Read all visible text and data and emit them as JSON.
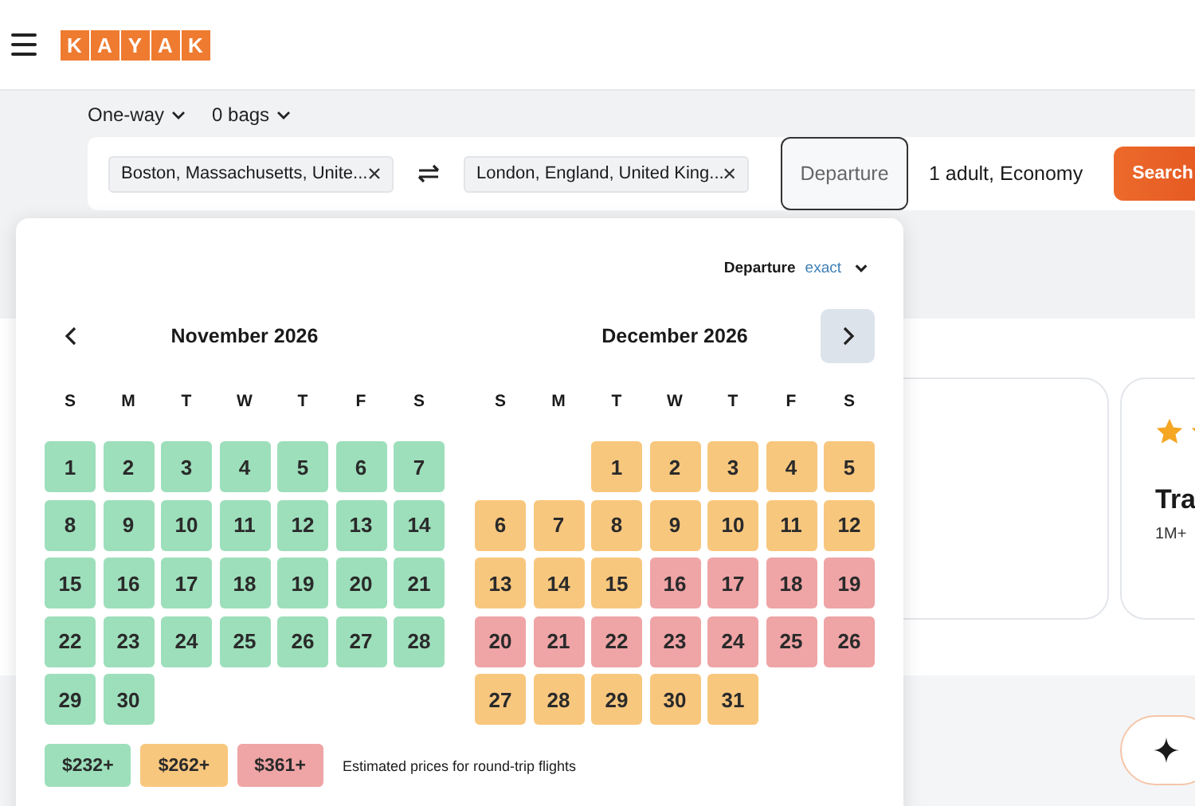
{
  "header": {
    "logo_letters": [
      "K",
      "A",
      "Y",
      "A",
      "K"
    ]
  },
  "trip_options": [
    {
      "label": "One-way"
    },
    {
      "label": "0 bags"
    }
  ],
  "search": {
    "origin": "Boston, Massachusetts, Unite...",
    "destination": "London, England, United King...",
    "departure_placeholder": "Departure",
    "travelers": "1 adult, Economy",
    "button": "Search"
  },
  "calendar": {
    "mode_label": "Departure",
    "mode_value": "exact",
    "months": [
      {
        "title": "November 2026",
        "weekdays": [
          "S",
          "M",
          "T",
          "W",
          "T",
          "F",
          "S"
        ],
        "weeks": [
          [
            {
              "day": "1",
              "kind": "low"
            },
            {
              "day": "2",
              "kind": "low"
            },
            {
              "day": "3",
              "kind": "low"
            },
            {
              "day": "4",
              "kind": "low"
            },
            {
              "day": "5",
              "kind": "low"
            },
            {
              "day": "6",
              "kind": "low"
            },
            {
              "day": "7",
              "kind": "low"
            }
          ],
          [
            {
              "day": "8",
              "kind": "low"
            },
            {
              "day": "9",
              "kind": "low"
            },
            {
              "day": "10",
              "kind": "low"
            },
            {
              "day": "11",
              "kind": "low"
            },
            {
              "day": "12",
              "kind": "low"
            },
            {
              "day": "13",
              "kind": "low"
            },
            {
              "day": "14",
              "kind": "low"
            }
          ],
          [
            {
              "day": "15",
              "kind": "low"
            },
            {
              "day": "16",
              "kind": "low"
            },
            {
              "day": "17",
              "kind": "low"
            },
            {
              "day": "18",
              "kind": "low"
            },
            {
              "day": "19",
              "kind": "low"
            },
            {
              "day": "20",
              "kind": "low"
            },
            {
              "day": "21",
              "kind": "low"
            }
          ],
          [
            {
              "day": "22",
              "kind": "low"
            },
            {
              "day": "23",
              "kind": "low"
            },
            {
              "day": "24",
              "kind": "low"
            },
            {
              "day": "25",
              "kind": "low"
            },
            {
              "day": "26",
              "kind": "low"
            },
            {
              "day": "27",
              "kind": "low"
            },
            {
              "day": "28",
              "kind": "low"
            }
          ],
          [
            {
              "day": "29",
              "kind": "low"
            },
            {
              "day": "30",
              "kind": "low"
            }
          ]
        ]
      },
      {
        "title": "December 2026",
        "weekdays": [
          "S",
          "M",
          "T",
          "W",
          "T",
          "F",
          "S"
        ],
        "weeks": [
          [
            {
              "kind": "blank"
            },
            {
              "kind": "blank"
            },
            {
              "day": "1",
              "kind": "mid"
            },
            {
              "day": "2",
              "kind": "mid"
            },
            {
              "day": "3",
              "kind": "mid"
            },
            {
              "day": "4",
              "kind": "mid"
            },
            {
              "day": "5",
              "kind": "mid"
            }
          ],
          [
            {
              "day": "6",
              "kind": "mid"
            },
            {
              "day": "7",
              "kind": "mid"
            },
            {
              "day": "8",
              "kind": "mid"
            },
            {
              "day": "9",
              "kind": "mid"
            },
            {
              "day": "10",
              "kind": "mid"
            },
            {
              "day": "11",
              "kind": "mid"
            },
            {
              "day": "12",
              "kind": "mid"
            }
          ],
          [
            {
              "day": "13",
              "kind": "mid"
            },
            {
              "day": "14",
              "kind": "mid"
            },
            {
              "day": "15",
              "kind": "mid"
            },
            {
              "day": "16",
              "kind": "high"
            },
            {
              "day": "17",
              "kind": "high"
            },
            {
              "day": "18",
              "kind": "high"
            },
            {
              "day": "19",
              "kind": "high"
            }
          ],
          [
            {
              "day": "20",
              "kind": "high"
            },
            {
              "day": "21",
              "kind": "high"
            },
            {
              "day": "22",
              "kind": "high"
            },
            {
              "day": "23",
              "kind": "high"
            },
            {
              "day": "24",
              "kind": "high"
            },
            {
              "day": "25",
              "kind": "high"
            },
            {
              "day": "26",
              "kind": "high"
            }
          ],
          [
            {
              "day": "27",
              "kind": "mid"
            },
            {
              "day": "28",
              "kind": "mid"
            },
            {
              "day": "29",
              "kind": "mid"
            },
            {
              "day": "30",
              "kind": "mid"
            },
            {
              "day": "31",
              "kind": "mid"
            }
          ]
        ]
      }
    ],
    "legend": [
      {
        "label": "$232+",
        "kind": "low"
      },
      {
        "label": "$262+",
        "kind": "mid"
      },
      {
        "label": "$361+",
        "kind": "high"
      }
    ],
    "legend_note": "Estimated prices for round-trip flights"
  },
  "promo_card": {
    "title": "Tra",
    "subtitle": "1M+"
  }
}
